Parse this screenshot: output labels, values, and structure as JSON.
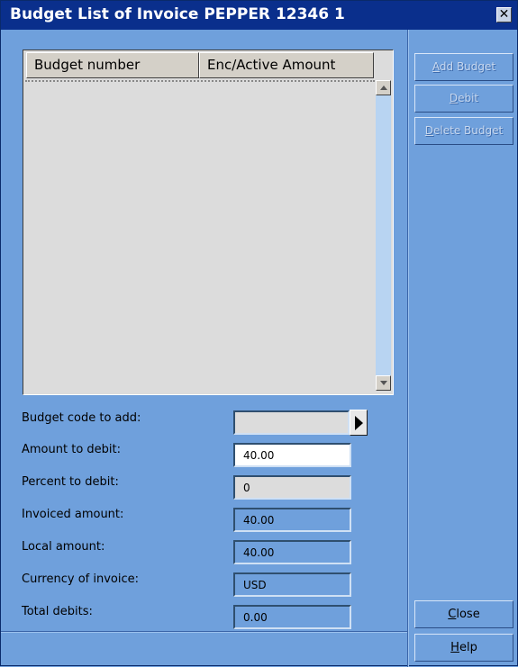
{
  "window": {
    "title": "Budget List of Invoice PEPPER 12346 1",
    "close_glyph": "✕"
  },
  "table": {
    "columns": [
      "Budget number",
      "Enc/Active Amount"
    ],
    "rows": []
  },
  "form": {
    "budget_code": {
      "label": "Budget code to add:",
      "value": ""
    },
    "amount_to_debit": {
      "label": "Amount to debit:",
      "value": "40.00"
    },
    "percent_to_debit": {
      "label": "Percent to debit:",
      "value": "0"
    },
    "invoiced_amount": {
      "label": "Invoiced amount:",
      "value": "40.00"
    },
    "local_amount": {
      "label": "Local amount:",
      "value": "40.00"
    },
    "currency": {
      "label": "Currency of invoice:",
      "value": "USD"
    },
    "total_debits": {
      "label": "Total debits:",
      "value": "0.00"
    }
  },
  "buttons": {
    "add_budget": {
      "mnemonic": "A",
      "rest": "dd Budget",
      "enabled": false
    },
    "debit": {
      "mnemonic": "D",
      "rest": "ebit",
      "enabled": false
    },
    "delete_budget": {
      "mnemonic": "D",
      "rest": "elete Budget",
      "enabled": false
    },
    "close": {
      "mnemonic": "C",
      "rest": "lose",
      "enabled": true
    },
    "help": {
      "mnemonic": "H",
      "rest": "elp",
      "enabled": true
    }
  },
  "colors": {
    "dialog_bg": "#6fa0dc",
    "titlebar_bg": "#0a2f8c",
    "list_bg": "#dcdcdc"
  }
}
